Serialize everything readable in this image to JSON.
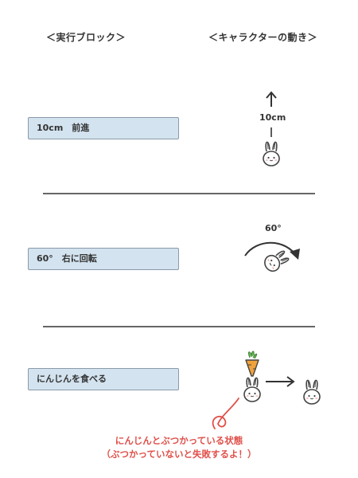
{
  "headers": {
    "blocks": "＜実行ブロック＞",
    "movement": "＜キャラクターの動き＞"
  },
  "rows": [
    {
      "block_label": "10cm　前進",
      "annotation": "10cm"
    },
    {
      "block_label": "60°　右に回転",
      "annotation": "60°"
    },
    {
      "block_label": "にんじんを食べる"
    }
  ],
  "note": {
    "line1": "にんじんとぶつかっている状態",
    "line2": "（ぶつかっていないと失敗するよ！）"
  },
  "colors": {
    "block_fill": "#d3e3ef",
    "block_border": "#8a9aa8",
    "note_red": "#e0504a",
    "carrot_orange": "#f0a23a"
  }
}
